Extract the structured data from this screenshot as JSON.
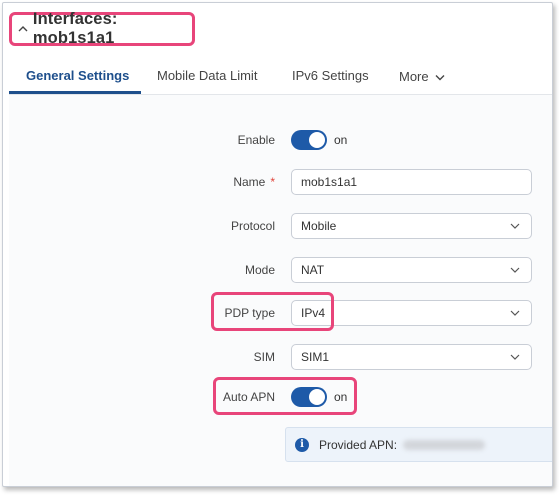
{
  "header": {
    "title": "Interfaces: mob1s1a1"
  },
  "tabs": [
    {
      "label": "General Settings"
    },
    {
      "label": "Mobile Data Limit"
    },
    {
      "label": "IPv6 Settings"
    },
    {
      "label": "More"
    }
  ],
  "form": {
    "enable": {
      "label": "Enable",
      "state": "on"
    },
    "name": {
      "label": "Name",
      "required_mark": "*",
      "value": "mob1s1a1"
    },
    "protocol": {
      "label": "Protocol",
      "value": "Mobile"
    },
    "mode": {
      "label": "Mode",
      "value": "NAT"
    },
    "pdp_type": {
      "label": "PDP type",
      "value": "IPv4"
    },
    "sim": {
      "label": "SIM",
      "value": "SIM1"
    },
    "auto_apn": {
      "label": "Auto APN",
      "state": "on"
    }
  },
  "info": {
    "icon": "info-icon",
    "text": "Provided APN:"
  },
  "colors": {
    "accent": "#1e5aa8",
    "highlight": "#e8457a"
  }
}
